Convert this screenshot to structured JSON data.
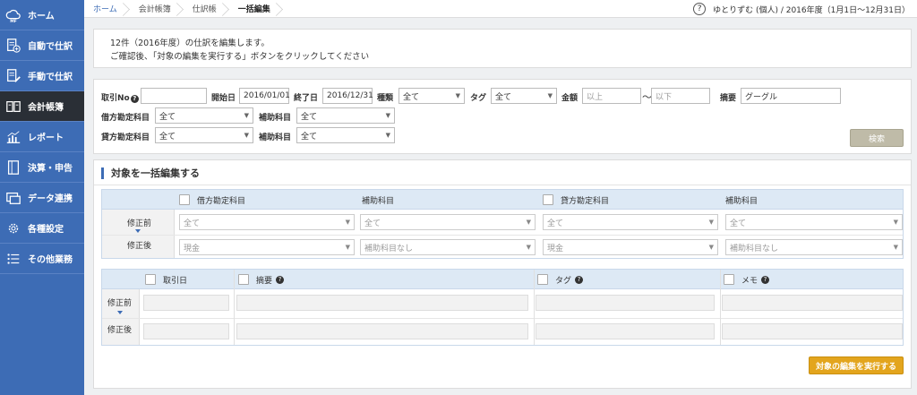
{
  "sidebar": {
    "items": [
      {
        "label": "ホーム",
        "icon": "cloud-mf-icon"
      },
      {
        "label": "自動で仕訳",
        "icon": "doc-add-icon"
      },
      {
        "label": "手動で仕訳",
        "icon": "doc-pen-icon"
      },
      {
        "label": "会計帳簿",
        "icon": "book-icon"
      },
      {
        "label": "レポート",
        "icon": "chart-icon"
      },
      {
        "label": "決算・申告",
        "icon": "folder-icon"
      },
      {
        "label": "データ連携",
        "icon": "data-link-icon"
      },
      {
        "label": "各種設定",
        "icon": "gear-icon"
      },
      {
        "label": "その他業務",
        "icon": "list-icon"
      }
    ],
    "active_index": 3
  },
  "breadcrumb": [
    "ホーム",
    "会計帳簿",
    "仕訳帳",
    "一括編集"
  ],
  "header": {
    "help": "?",
    "user": "ゆとりずむ (個人) / 2016年度（1月1日〜12月31日）"
  },
  "notice": {
    "line1": "12件（2016年度）の仕訳を編集します。",
    "line2": "ご確認後、「対象の編集を実行する」ボタンをクリックしてください"
  },
  "search": {
    "entry_no_label": "取引No",
    "start_label": "開始日",
    "start_value": "2016/01/01",
    "end_label": "終了日",
    "end_value": "2016/12/31",
    "kind_label": "種類",
    "kind_value": "全て",
    "tag_label": "タグ",
    "tag_value": "全て",
    "amount_label": "金額",
    "amount_min_placeholder": "以上",
    "amount_sep": "〜",
    "amount_max_placeholder": "以下",
    "summary_label": "摘要",
    "summary_value": "グーグル",
    "debit_label": "借方勘定科目",
    "debit_value": "全て",
    "debit_sub_label": "補助科目",
    "debit_sub_value": "全て",
    "credit_label": "貸方勘定科目",
    "credit_value": "全て",
    "credit_sub_label": "補助科目",
    "credit_sub_value": "全て",
    "search_button": "検索"
  },
  "bulk": {
    "title": "対象を一括編集する",
    "grid1": {
      "headers": [
        "借方勘定科目",
        "補助科目",
        "貸方勘定科目",
        "補助科目"
      ],
      "row_before": "修正前",
      "row_after": "修正後",
      "before": [
        "全て",
        "全て",
        "全て",
        "全て"
      ],
      "after": [
        "現金",
        "補助科目なし",
        "現金",
        "補助科目なし"
      ]
    },
    "grid2": {
      "headers": [
        "取引日",
        "摘要",
        "タグ",
        "メモ"
      ],
      "row_before": "修正前",
      "row_after": "修正後"
    },
    "execute_button": "対象の編集を実行する"
  }
}
